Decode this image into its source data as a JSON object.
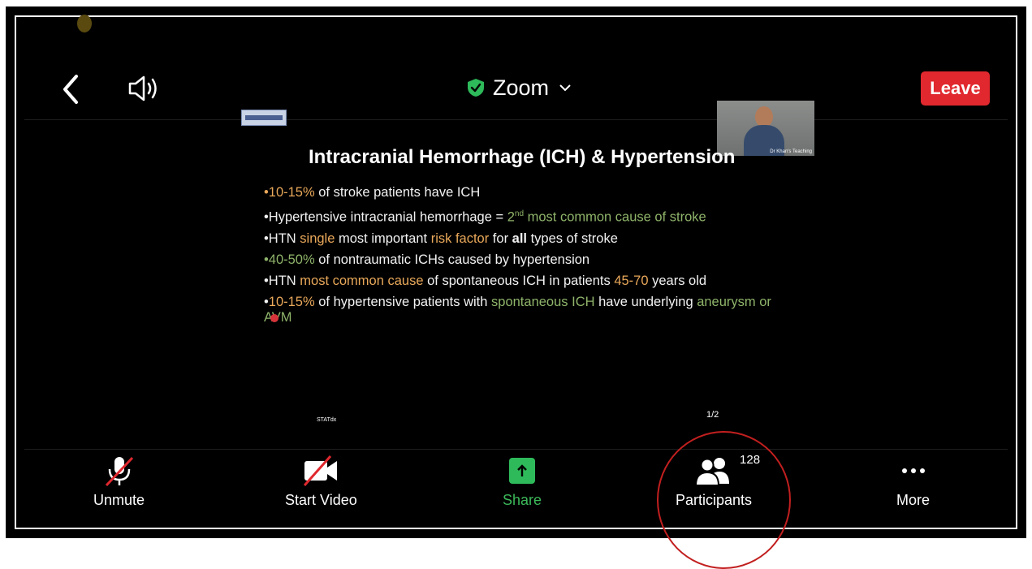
{
  "header": {
    "title": "Zoom",
    "leave_label": "Leave",
    "icons": [
      "back-icon",
      "speaker-icon",
      "shield-check-icon",
      "chevron-down-icon"
    ]
  },
  "slide": {
    "title": "Intracranial Hemorrhage (ICH) & Hypertension",
    "bullets": [
      [
        {
          "t": "•",
          "c": "o"
        },
        {
          "t": "10-15%",
          "c": "o"
        },
        {
          "t": " of stroke patients have ICH"
        }
      ],
      [
        {
          "t": "•Hypertensive intracranial hemorrhage = "
        },
        {
          "t": "2",
          "c": "g"
        },
        {
          "t": "nd",
          "c": "g",
          "sup": true
        },
        {
          "t": " most common cause of stroke",
          "c": "g"
        }
      ],
      [
        {
          "t": "•HTN "
        },
        {
          "t": "single",
          "c": "o"
        },
        {
          "t": " most important "
        },
        {
          "t": "risk factor",
          "c": "o"
        },
        {
          "t": " for "
        },
        {
          "t": "all",
          "b": true
        },
        {
          "t": " types of stroke"
        }
      ],
      [
        {
          "t": "•40-50%",
          "c": "g"
        },
        {
          "t": " of nontraumatic ICHs caused by hypertension"
        }
      ],
      [
        {
          "t": "•HTN "
        },
        {
          "t": "most common cause",
          "c": "o"
        },
        {
          "t": " of spontaneous ICH in patients "
        },
        {
          "t": "45-70",
          "c": "o"
        },
        {
          "t": " years old"
        }
      ],
      [
        {
          "t": "•"
        },
        {
          "t": "10-15%",
          "c": "o"
        },
        {
          "t": " of hypertensive patients with "
        },
        {
          "t": "spontaneous ICH",
          "c": "g"
        },
        {
          "t": " have underlying "
        },
        {
          "t": "aneurysm or AVM",
          "c": "g"
        }
      ]
    ],
    "footer_left": "STATdx",
    "page": "1/2",
    "video_tag": "Dr Khan's Teaching"
  },
  "controls": {
    "unmute_label": "Unmute",
    "video_label": "Start Video",
    "share_label": "Share",
    "participants_label": "Participants",
    "participants_count": "128",
    "more_label": "More"
  },
  "colors": {
    "leave": "#e0282e",
    "share": "#2eba5a",
    "highlight_orange": "#e9a85a",
    "highlight_green": "#8fb46a",
    "annotation_circle": "#c21f1f"
  }
}
